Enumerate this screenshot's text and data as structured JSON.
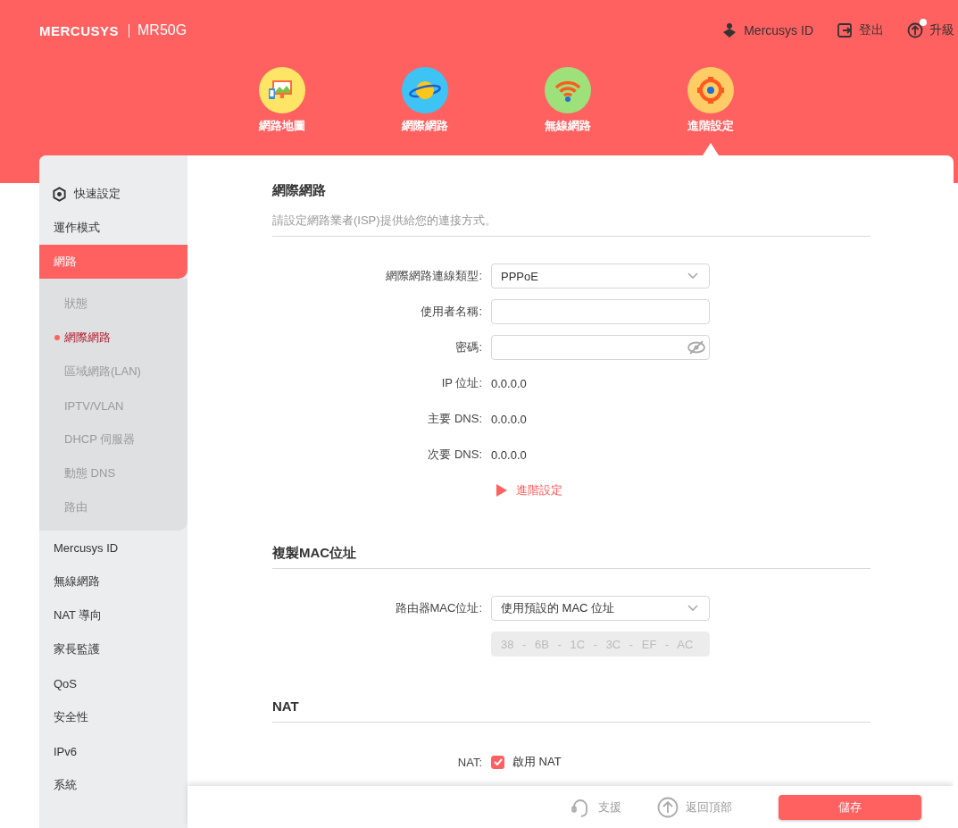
{
  "header": {
    "logo": "MERCUSYS",
    "model": "MR50G",
    "links": [
      {
        "kind": "account",
        "label": "Mercusys ID"
      },
      {
        "kind": "logout",
        "label": "登出"
      },
      {
        "kind": "upgrade",
        "label": "升級",
        "notice": true
      }
    ]
  },
  "nav": [
    {
      "kind": "map",
      "label": "網路地圖",
      "selected": false
    },
    {
      "kind": "internet",
      "label": "網際網路",
      "selected": false
    },
    {
      "kind": "wireless",
      "label": "無線網路",
      "selected": false
    },
    {
      "kind": "advanced",
      "label": "進階設定",
      "selected": true
    }
  ],
  "sidebar": {
    "items": [
      {
        "kind": "setup",
        "label": "快速設定",
        "selected": false
      },
      {
        "kind": "plain",
        "label": "運作模式",
        "selected": false
      },
      {
        "kind": "plain",
        "label": "網路",
        "selected": true,
        "expanded": true,
        "children": [
          {
            "label": "狀態",
            "selected": false
          },
          {
            "label": "網際網路",
            "selected": true
          },
          {
            "label": "區域網路(LAN)",
            "selected": false
          },
          {
            "label": "IPTV/VLAN",
            "selected": false
          },
          {
            "label": "DHCP 伺服器",
            "selected": false
          },
          {
            "label": "動態 DNS",
            "selected": false
          },
          {
            "label": "路由",
            "selected": false
          }
        ]
      },
      {
        "kind": "plain",
        "label": "Mercusys ID",
        "selected": false
      },
      {
        "kind": "plain",
        "label": "無線網路",
        "selected": false
      },
      {
        "kind": "plain",
        "label": "NAT 導向",
        "selected": false
      },
      {
        "kind": "plain",
        "label": "家長監護",
        "selected": false
      },
      {
        "kind": "plain",
        "label": "QoS",
        "selected": false
      },
      {
        "kind": "plain",
        "label": "安全性",
        "selected": false
      },
      {
        "kind": "plain",
        "label": "IPv6",
        "selected": false
      },
      {
        "kind": "plain",
        "label": "系統",
        "selected": false
      }
    ]
  },
  "sections": [
    {
      "title": "網際網路",
      "description": "請設定網路業者(ISP)提供給您的連接方式。",
      "rows": [
        {
          "kind": "select",
          "label": "網際網路連線類型:",
          "value": "PPPoE"
        },
        {
          "kind": "text",
          "label": "使用者名稱:"
        },
        {
          "kind": "password",
          "label": "密碼:"
        },
        {
          "kind": "value",
          "label": "IP 位址:",
          "value": "0.0.0.0"
        },
        {
          "kind": "value",
          "label": "主要 DNS:",
          "value": "0.0.0.0"
        },
        {
          "kind": "value",
          "label": "次要 DNS:",
          "value": "0.0.0.0"
        },
        {
          "kind": "link",
          "text": "進階設定"
        }
      ]
    },
    {
      "title": "複製MAC位址",
      "rows": [
        {
          "kind": "select",
          "label": "路由器MAC位址:",
          "value": "使用預設的 MAC 位址"
        },
        {
          "kind": "mac",
          "value": "38 - 6B - 1C - 3C - EF - AC",
          "disabled": true
        }
      ]
    },
    {
      "title": "NAT",
      "rows": [
        {
          "kind": "checkbox",
          "label": "NAT:",
          "text": "啟用 NAT",
          "checked": true
        }
      ]
    }
  ],
  "footer": {
    "links": [
      {
        "kind": "support",
        "label": "支援"
      },
      {
        "kind": "top",
        "label": "返回頂部"
      }
    ],
    "save": "儲存"
  }
}
